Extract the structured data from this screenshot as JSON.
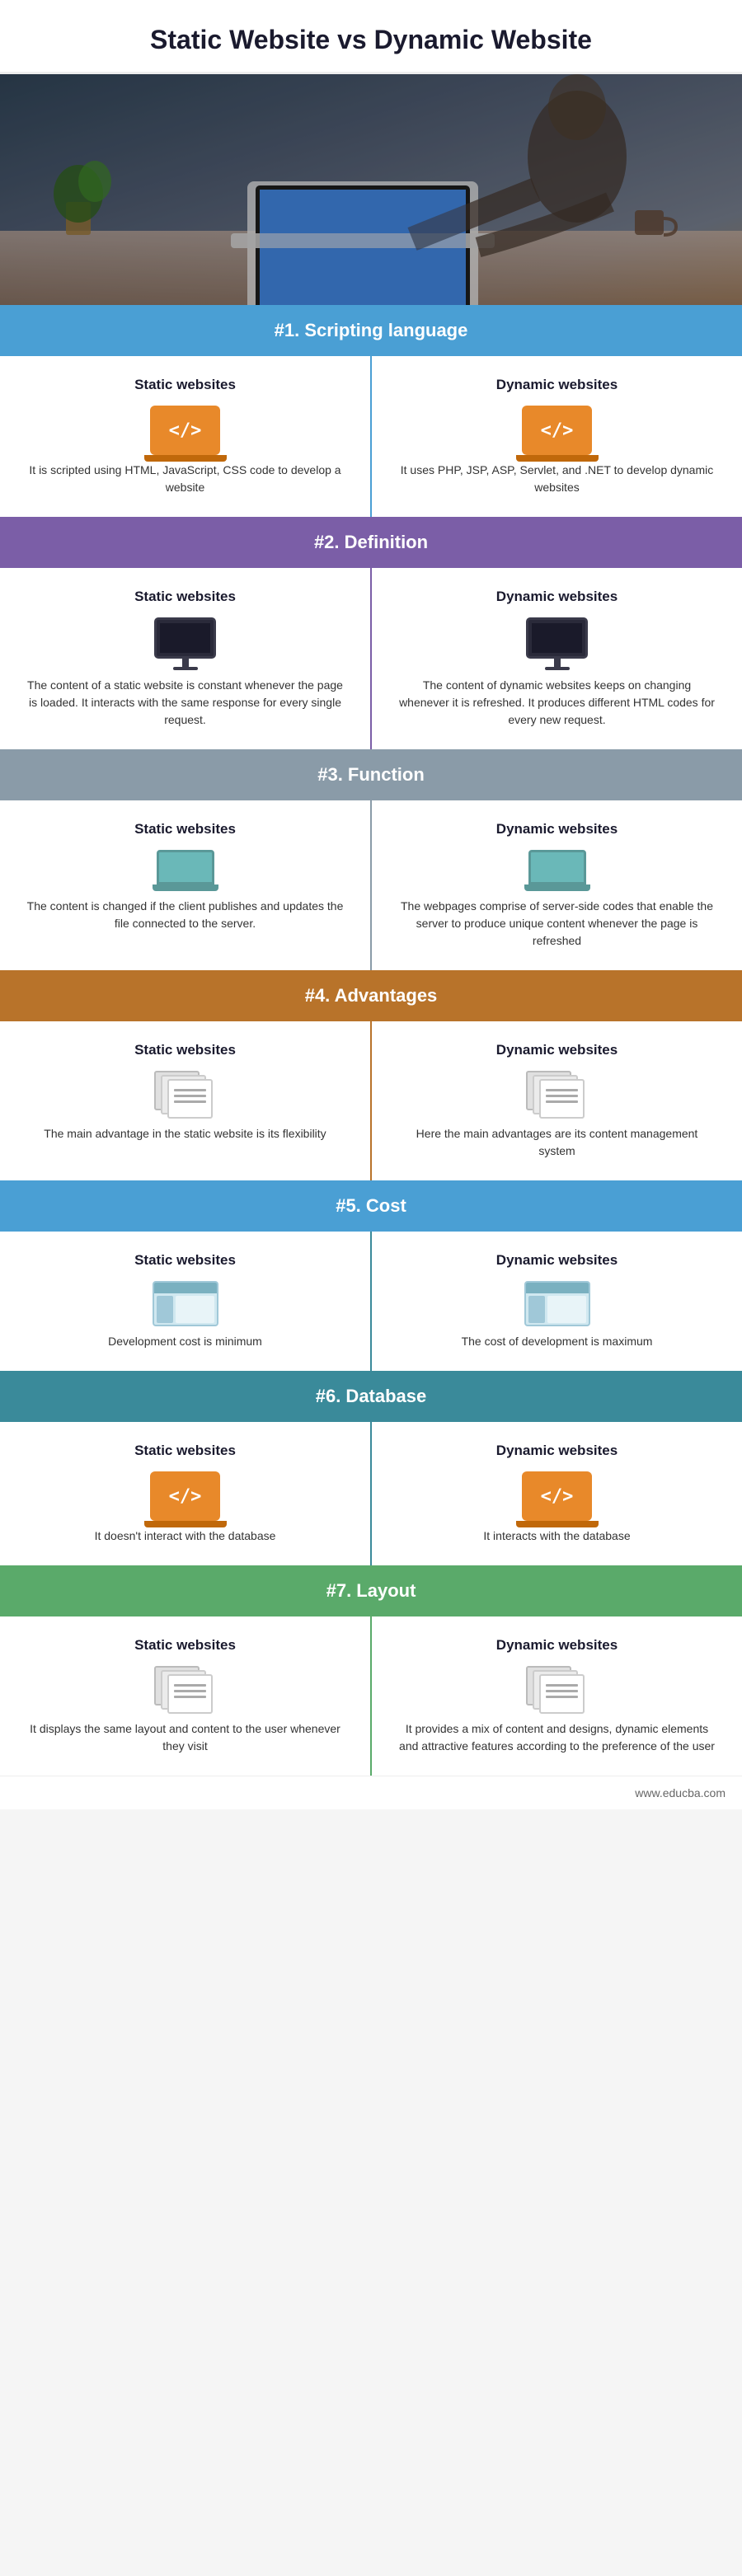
{
  "title": "Static Website vs Dynamic Website",
  "hero": {
    "alt": "Person working on laptop at desk"
  },
  "sections": [
    {
      "id": "scripting",
      "number": "#1.",
      "label": "Scripting language",
      "color": "blue",
      "line_color": "blue",
      "static_title": "Static websites",
      "dynamic_title": "Dynamic websites",
      "static_icon": "code",
      "dynamic_icon": "code",
      "static_text": "It is scripted using HTML, JavaScript, CSS code to develop a website",
      "dynamic_text": "It uses PHP, JSP, ASP, Servlet, and .NET to develop dynamic websites"
    },
    {
      "id": "definition",
      "number": "#2.",
      "label": "Definition",
      "color": "purple",
      "line_color": "purple",
      "static_title": "Static websites",
      "dynamic_title": "Dynamic websites",
      "static_icon": "monitor",
      "dynamic_icon": "monitor",
      "static_text": "The content of a static website is constant whenever the page is loaded. It interacts with the same response for every single request.",
      "dynamic_text": "The content of dynamic websites keeps on changing whenever it is refreshed. It produces different HTML codes for every new request."
    },
    {
      "id": "function",
      "number": "#3.",
      "label": "Function",
      "color": "gray",
      "line_color": "gray",
      "static_title": "Static websites",
      "dynamic_title": "Dynamic websites",
      "static_icon": "laptop",
      "dynamic_icon": "laptop",
      "static_text": "The content is changed if the client publishes and updates the file connected to the server.",
      "dynamic_text": "The webpages comprise of server-side codes that enable the server to produce unique content whenever the page is refreshed"
    },
    {
      "id": "advantages",
      "number": "#4.",
      "label": "Advantages",
      "color": "brown",
      "line_color": "brown",
      "static_title": "Static websites",
      "dynamic_title": "Dynamic websites",
      "static_icon": "pages",
      "dynamic_icon": "pages",
      "static_text": "The main advantage in the static website is its flexibility",
      "dynamic_text": "Here the main advantages are its content management system"
    },
    {
      "id": "cost",
      "number": "#5.",
      "label": "Cost",
      "color": "teal",
      "line_color": "teal",
      "static_title": "Static websites",
      "dynamic_title": "Dynamic websites",
      "static_icon": "web",
      "dynamic_icon": "web",
      "static_text": "Development cost is minimum",
      "dynamic_text": "The cost of development is maximum"
    },
    {
      "id": "database",
      "number": "#6.",
      "label": "Database",
      "color": "teal2",
      "line_color": "teal",
      "static_title": "Static websites",
      "dynamic_title": "Dynamic websites",
      "static_icon": "code",
      "dynamic_icon": "code",
      "static_text": "It doesn't interact with the database",
      "dynamic_text": "It interacts with the database"
    },
    {
      "id": "layout",
      "number": "#7.",
      "label": "Layout",
      "color": "green",
      "line_color": "green",
      "static_title": "Static websites",
      "dynamic_title": "Dynamic websites",
      "static_icon": "pages",
      "dynamic_icon": "pages",
      "static_text": "It displays the same layout and content to the user whenever they visit",
      "dynamic_text": "It provides a mix of content and designs, dynamic elements and attractive features according to the preference of the user"
    }
  ],
  "footer": "www.educba.com"
}
